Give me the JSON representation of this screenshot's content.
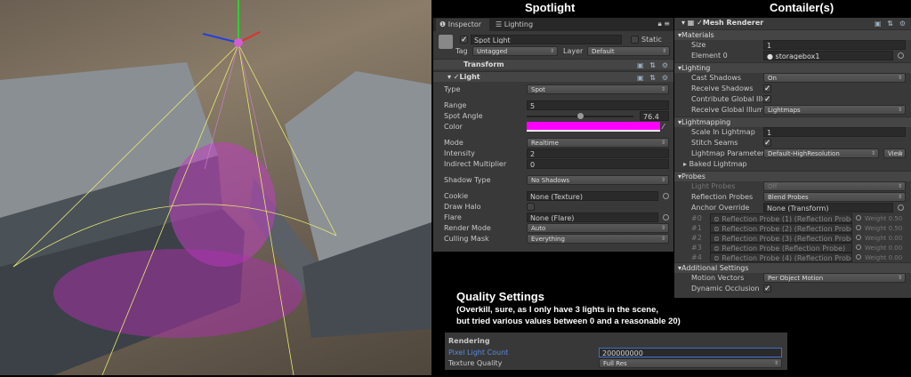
{
  "headings": {
    "spotlight": "Spotlight",
    "containers": "Contailer(s)"
  },
  "inspector": {
    "tabs": [
      "Inspector",
      "Lighting"
    ],
    "object_name": "Spot Light",
    "static_label": "Static",
    "tag_label": "Tag",
    "tag_value": "Untagged",
    "layer_label": "Layer",
    "layer_value": "Default",
    "transform": "Transform",
    "light": "Light",
    "fields": {
      "type": {
        "label": "Type",
        "value": "Spot"
      },
      "range": {
        "label": "Range",
        "value": "5"
      },
      "spot_angle": {
        "label": "Spot Angle",
        "value": "76.4",
        "fraction": 0.5
      },
      "color": {
        "label": "Color",
        "value": "#ff00ff"
      },
      "mode": {
        "label": "Mode",
        "value": "Realtime"
      },
      "intensity": {
        "label": "Intensity",
        "value": "2"
      },
      "indirect": {
        "label": "Indirect Multiplier",
        "value": "0"
      },
      "shadow": {
        "label": "Shadow Type",
        "value": "No Shadows"
      },
      "cookie": {
        "label": "Cookie",
        "value": "None (Texture)"
      },
      "halo": {
        "label": "Draw Halo"
      },
      "flare": {
        "label": "Flare",
        "value": "None (Flare)"
      },
      "render": {
        "label": "Render Mode",
        "value": "Auto"
      },
      "culling": {
        "label": "Culling Mask",
        "value": "Everything"
      }
    }
  },
  "mesh": {
    "title": "Mesh Renderer",
    "materials": "Materials",
    "size_label": "Size",
    "size": "1",
    "element_label": "Element 0",
    "element": "storagebox1",
    "lighting": "Lighting",
    "cast_label": "Cast Shadows",
    "cast": "On",
    "receive_label": "Receive Shadows",
    "contribute_label": "Contribute Global Illu",
    "receive_gi_label": "Receive Global Illumi",
    "receive_gi": "Lightmaps",
    "lightmapping": "Lightmapping",
    "scale_label": "Scale In Lightmap",
    "scale": "1",
    "stitch_label": "Stitch Seams",
    "lm_params_label": "Lightmap Parameters",
    "lm_params": "Default-HighResolution",
    "view": "View",
    "baked": "Baked Lightmap",
    "probes": "Probes",
    "light_probes_label": "Light Probes",
    "light_probes": "Off",
    "refl_label": "Reflection Probes",
    "refl": "Blend Probes",
    "anchor_label": "Anchor Override",
    "anchor": "None (Transform)",
    "probe_list": [
      {
        "idx": "#0",
        "name": "Reflection Probe (1) (Reflection Probe",
        "weight": "Weight 0.50"
      },
      {
        "idx": "#1",
        "name": "Reflection Probe (2) (Reflection Probe",
        "weight": "Weight 0.50"
      },
      {
        "idx": "#2",
        "name": "Reflection Probe (3) (Reflection Probe",
        "weight": "Weight 0.00"
      },
      {
        "idx": "#3",
        "name": "Reflection Probe (Reflection Probe)",
        "weight": "Weight 0.00"
      },
      {
        "idx": "#4",
        "name": "Reflection Probe (4) (Reflection Probe",
        "weight": "Weight 0.00"
      }
    ],
    "additional": "Additional Settings",
    "motion_label": "Motion Vectors",
    "motion": "Per Object Motion",
    "occlusion_label": "Dynamic Occlusion"
  },
  "quality": {
    "title": "Quality Settings",
    "note1": "(Overkill, sure, as I only have 3 lights in the scene,",
    "note2": "but tried various values between 0 and a reasonable 20)",
    "section": "Rendering",
    "pixel_label": "Pixel Light Count",
    "pixel_value": "200000000",
    "texture_label": "Texture Quality",
    "texture_value": "Full Res"
  }
}
